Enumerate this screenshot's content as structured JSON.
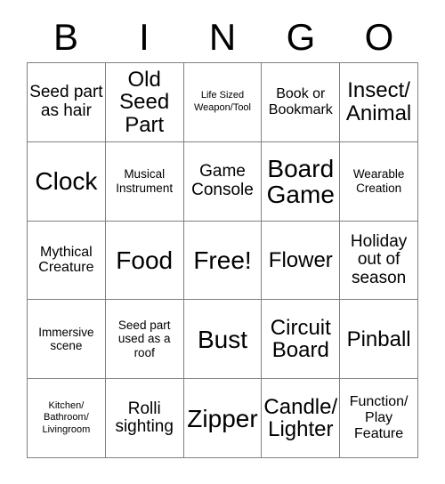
{
  "card": {
    "title": "BINGO",
    "header_letters": [
      "B",
      "I",
      "N",
      "G",
      "O"
    ],
    "free_space_index": 12,
    "colors": {
      "background": "#ffffff",
      "grid_line": "#808080",
      "text": "#000000"
    },
    "rows": 5,
    "columns": 5,
    "cells": [
      {
        "text": "Seed part as hair",
        "size": "lg"
      },
      {
        "text": "Old Seed Part",
        "size": "xl"
      },
      {
        "text": "Life Sized Weapon/Tool",
        "size": "xs"
      },
      {
        "text": "Book or Bookmark",
        "size": "md"
      },
      {
        "text": "Insect/ Animal",
        "size": "xl"
      },
      {
        "text": "Clock",
        "size": "xxl"
      },
      {
        "text": "Musical Instrument",
        "size": "sm"
      },
      {
        "text": "Game Console",
        "size": "lg"
      },
      {
        "text": "Board Game",
        "size": "xxl"
      },
      {
        "text": "Wearable Creation",
        "size": "sm"
      },
      {
        "text": "Mythical Creature",
        "size": "md"
      },
      {
        "text": "Food",
        "size": "xxl"
      },
      {
        "text": "Free!",
        "size": "xxl"
      },
      {
        "text": "Flower",
        "size": "xl"
      },
      {
        "text": "Holiday out of season",
        "size": "lg"
      },
      {
        "text": "Immersive scene",
        "size": "sm"
      },
      {
        "text": "Seed part used as a roof",
        "size": "sm"
      },
      {
        "text": "Bust",
        "size": "xxl"
      },
      {
        "text": "Circuit Board",
        "size": "xl"
      },
      {
        "text": "Pinball",
        "size": "xl"
      },
      {
        "text": "Kitchen/ Bathroom/ Livingroom",
        "size": "xs"
      },
      {
        "text": "Rolli sighting",
        "size": "lg"
      },
      {
        "text": "Zipper",
        "size": "xxl"
      },
      {
        "text": "Candle/ Lighter",
        "size": "xl"
      },
      {
        "text": "Function/ Play Feature",
        "size": "md"
      }
    ]
  }
}
